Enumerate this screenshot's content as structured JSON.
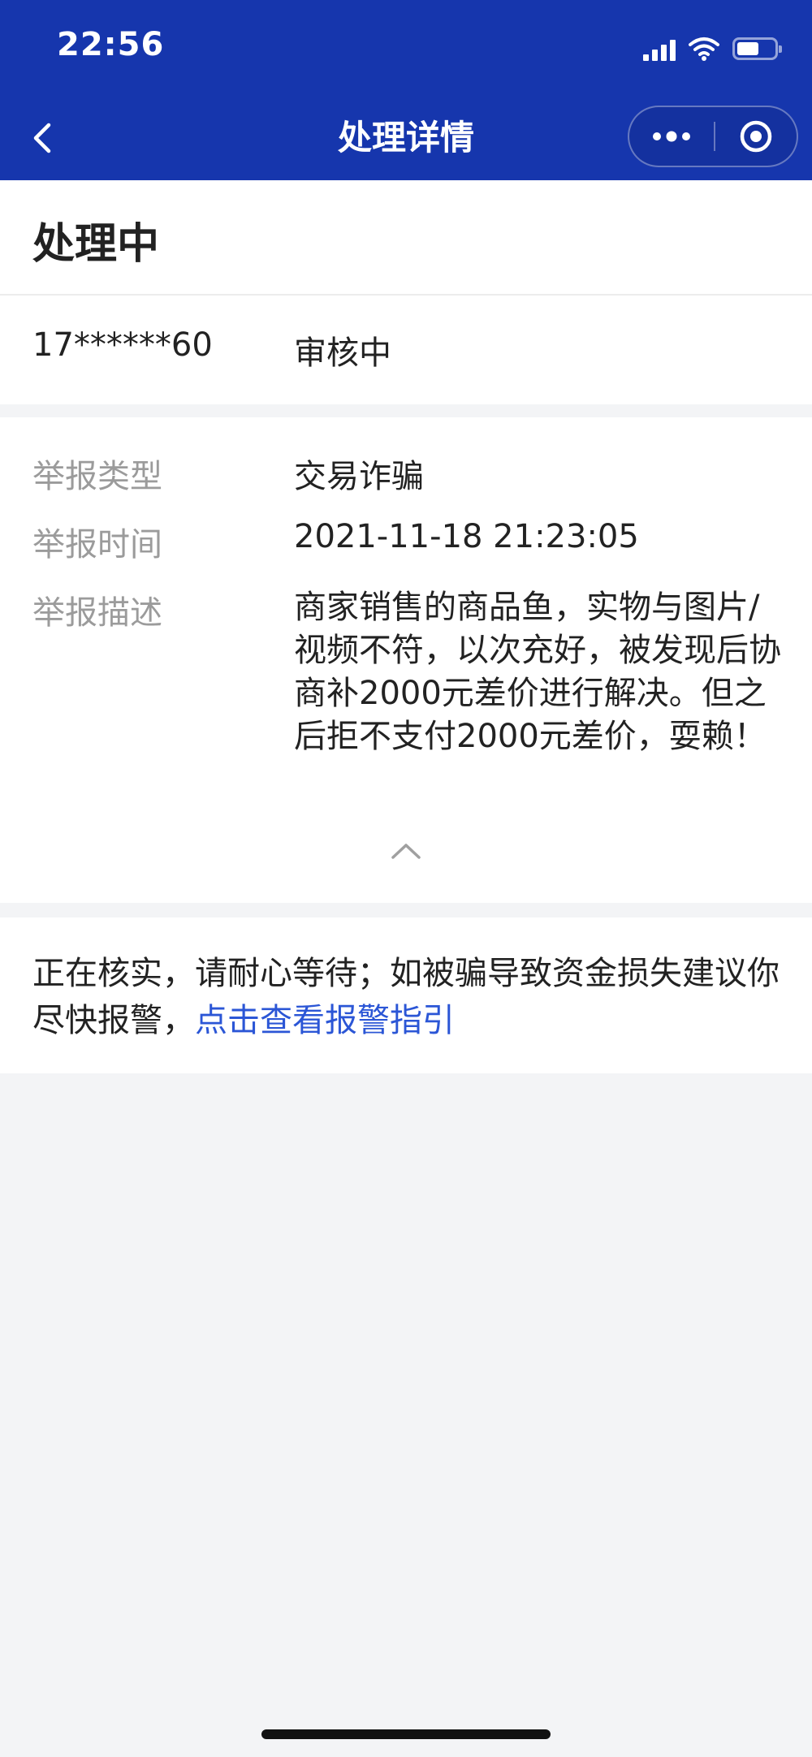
{
  "status_bar": {
    "time": "22:56"
  },
  "nav": {
    "title": "处理详情"
  },
  "status": {
    "title": "处理中",
    "account": "17******60",
    "review_state": "审核中"
  },
  "details": {
    "type_label": "举报类型",
    "type_value": "交易诈骗",
    "time_label": "举报时间",
    "time_value": "2021-11-18 21:23:05",
    "desc_label": "举报描述",
    "desc_value": "商家销售的商品鱼，实物与图片/视频不符，以次充好，被发现后协商补2000元差价进行解决。但之后拒不支付2000元差价，耍赖！"
  },
  "notice": {
    "text": "正在核实，请耐心等待；如被骗导致资金损失建议你尽快报警，",
    "link": "点击查看报警指引"
  },
  "colors": {
    "header": "#1636ad",
    "link": "#2b56d6",
    "label": "#9b9b9b",
    "background": "#f3f4f6"
  }
}
